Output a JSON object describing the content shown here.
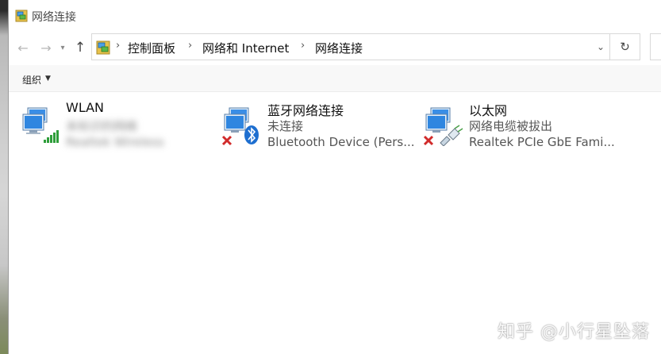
{
  "window": {
    "title": "网络连接"
  },
  "nav": {
    "back_icon": "back-arrow-icon",
    "forward_icon": "forward-arrow-icon",
    "recent_icon": "chevron-down-icon",
    "up_icon": "up-arrow-icon"
  },
  "address": {
    "breadcrumbs": [
      "控制面板",
      "网络和 Internet",
      "网络连接"
    ],
    "refresh_icon": "refresh-icon",
    "dropdown_icon": "chevron-down-icon"
  },
  "command_bar": {
    "organize_label": "组织"
  },
  "connections": [
    {
      "name": "WLAN",
      "status": "未标识的网络",
      "device": "Realtek Wireless",
      "icon": "wifi-signal-icon",
      "status_obscured": true
    },
    {
      "name": "蓝牙网络连接",
      "status": "未连接",
      "device": "Bluetooth Device (Pers...",
      "icon": "bluetooth-icon",
      "disconnected": true
    },
    {
      "name": "以太网",
      "status": "网络电缆被拔出",
      "device": "Realtek PCIe GbE Fami...",
      "icon": "ethernet-cable-icon",
      "disconnected": true
    }
  ],
  "watermark": "知乎 @小行星坠落",
  "colors": {
    "monitor_blue": "#3a8ee6",
    "error_red": "#d12b2b",
    "signal_green": "#2e9e3a",
    "bluetooth_blue": "#1e6fd0"
  }
}
